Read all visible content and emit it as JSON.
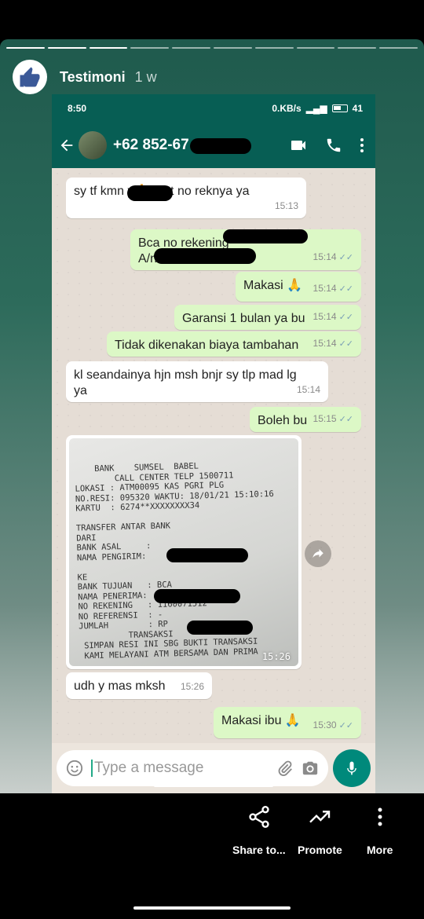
{
  "story": {
    "name": "Testimoni",
    "age": "1 w",
    "segments": 10,
    "current_segment": 3
  },
  "phone": {
    "status_time": "8:50",
    "status_speed": "0.KB/s",
    "status_battery": "41",
    "contact": "+62 852-67"
  },
  "messages": [
    {
      "dir": "in",
      "text": "sy tf kmn           y🙏 mnt no reknya ya",
      "time": "15:13"
    },
    {
      "dir": "out",
      "text": "Bca no rekening",
      "text2": "A/n",
      "time": "15:14"
    },
    {
      "dir": "out",
      "text": "Makasi 🙏",
      "time": "15:14"
    },
    {
      "dir": "out",
      "text": "Garansi 1 bulan ya bu",
      "time": "15:14"
    },
    {
      "dir": "out",
      "text": "Tidak dikenakan biaya tambahan",
      "time": "15:14"
    },
    {
      "dir": "in",
      "text": "kl seandainya hjn msh bnjr sy tlp mad lg",
      "text2": "ya",
      "time": "15:14"
    },
    {
      "dir": "out",
      "text": "Boleh bu",
      "time": "15:15"
    },
    {
      "dir": "in",
      "text": "udh y mas mksh",
      "time": "15:26"
    },
    {
      "dir": "out",
      "text": "Makasi ibu 🙏",
      "time": "15:30"
    }
  ],
  "receipt": {
    "time": "15:26",
    "text": "    BANK    SUMSEL  BABEL\n        CALL CENTER TELP 1500711\nLOKASI : ATM00095 KAS PGRI PLG\nNO.RESI: 095320 WAKTU: 18/01/21 15:10:16\nKARTU  : 6274**XXXXXXXX34\n\nTRANSFER ANTAR BANK\nDARI\nBANK ASAL     :\nNAMA PENGIRIM:\n\nKE\nBANK TUJUAN   : BCA\nNAMA PENERIMA:\nNO REKENING   : 1160071512\nNO REFERENSI  : -\nJUMLAH        : RP\n          TRANSAKSI\n SIMPAN RESI INI SBG BUKTI TRANSAKSI\n KAMI MELAYANI ATM BERSAMA DAN PRIMA"
  },
  "composer": {
    "placeholder": "Type a message"
  },
  "actions": {
    "share": "Share to...",
    "promote": "Promote",
    "more": "More"
  }
}
